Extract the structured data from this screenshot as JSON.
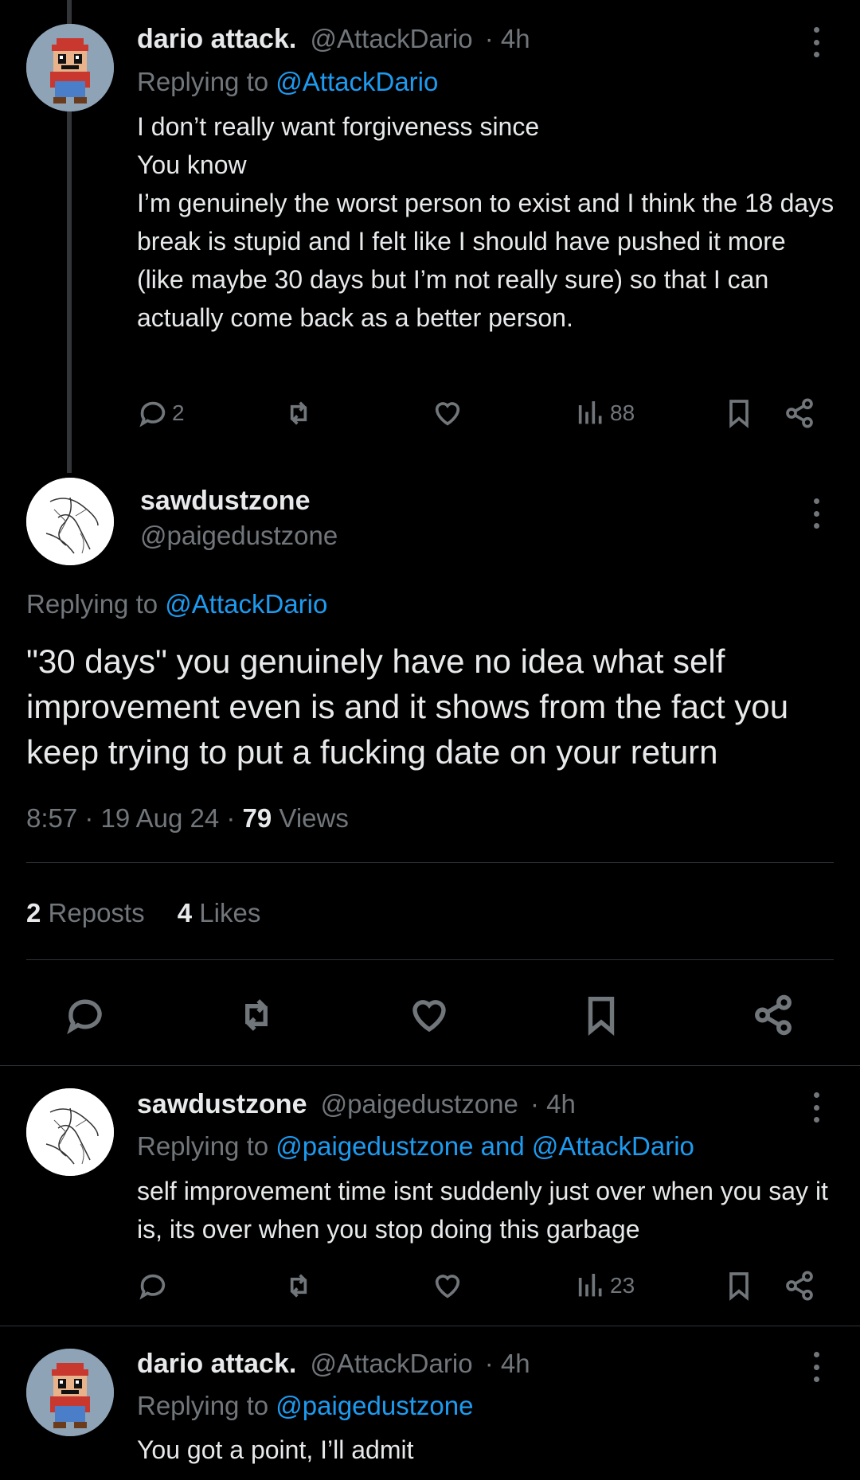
{
  "tweets": [
    {
      "name": "dario attack.",
      "handle": "@AttackDario",
      "time": "· 4h",
      "replying_prefix": "Replying to",
      "replying_to": "@AttackDario",
      "text": "I don’t really want forgiveness since\nYou know\nI’m genuinely the worst person to exist and I think the 18 days break is stupid and I felt like I should have pushed it more (like maybe 30 days but I’m not really sure) so that I can actually come back as a better person.",
      "replies": "2",
      "views": "88"
    }
  ],
  "main": {
    "name": "sawdustzone",
    "handle": "@paigedustzone",
    "replying_prefix": "Replying to",
    "replying_to": "@AttackDario",
    "text": "\"30 days\" you genuinely have no idea what self improvement even is and it shows from the fact you keep trying to put a fucking date on your return",
    "timestamp": "8:57 · 19 Aug 24 · ",
    "views_count": "79",
    "views_label": " Views",
    "reposts_count": "2",
    "reposts_label": "Reposts",
    "likes_count": "4",
    "likes_label": "Likes"
  },
  "reply1": {
    "name": "sawdustzone",
    "handle": "@paigedustzone",
    "time": "· 4h",
    "replying_prefix": "Replying to",
    "replying_to": "@paigedustzone and @AttackDario",
    "text": "self improvement time isnt suddenly just over when you say it is, its over when you stop doing this garbage",
    "views": "23"
  },
  "reply2": {
    "name": "dario attack.",
    "handle": "@AttackDario",
    "time": "· 4h",
    "replying_prefix": "Replying to",
    "replying_to": "@paigedustzone",
    "text": "You got a point, I’ll admit"
  },
  "colors": {
    "background": "#000000",
    "text": "#e7e9ea",
    "muted": "#71767b",
    "link": "#1d9bf0",
    "divider": "#2f3336"
  },
  "icons": [
    "more-icon",
    "reply-icon",
    "repost-icon",
    "like-icon",
    "views-icon",
    "bookmark-icon",
    "share-icon"
  ]
}
